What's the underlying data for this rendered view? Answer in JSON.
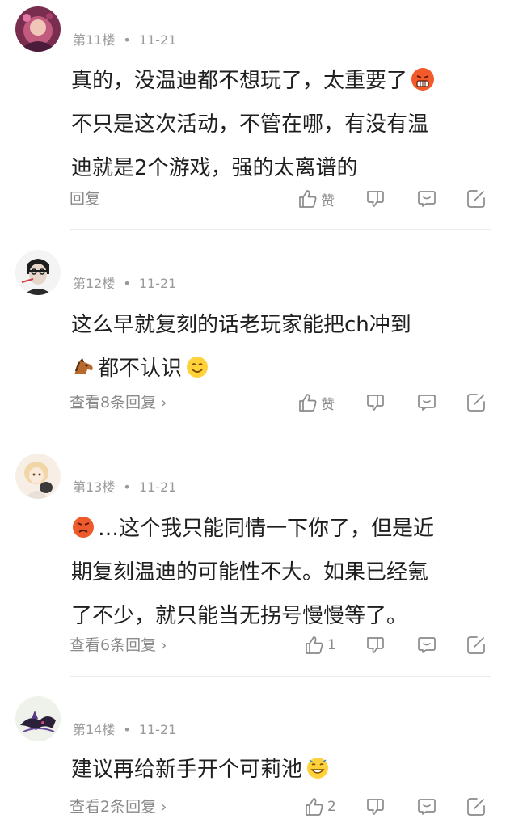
{
  "comments": [
    {
      "nickname": "",
      "floor": "第11楼",
      "date": "11-21",
      "lines": [
        "真的，没温迪都不想玩了，太重要了",
        "不只是这次活动，不管在哪，有没有温",
        "迪就是2个游戏，强的太离谱的"
      ],
      "emojis": [
        "angry-face-emoji"
      ],
      "reply_label": "回复",
      "like_label": "赞"
    },
    {
      "nickname": "",
      "floor": "第12楼",
      "date": "11-21",
      "lines": [
        "这么早就复刻的话老玩家能把ch冲到",
        "都不认识"
      ],
      "emojis": [
        "horse-emoji",
        "smile-emoji"
      ],
      "reply_label": "查看8条回复",
      "like_label": "赞"
    },
    {
      "nickname": "",
      "floor": "第13楼",
      "date": "11-21",
      "lines": [
        "…这个我只能同情一下你了，但是近",
        "期复刻温迪的可能性不大。如果已经氪",
        "了不少，就只能当无拐号慢慢等了。"
      ],
      "emojis": [
        "pouting-face-emoji"
      ],
      "reply_label": "查看6条回复",
      "like_label": "1"
    },
    {
      "nickname": "",
      "floor": "第14楼",
      "date": "11-21",
      "lines": [
        "建议再给新手开个可莉池"
      ],
      "emojis": [
        "grin-emoji"
      ],
      "reply_label": "查看2条回复",
      "like_label": "2"
    }
  ],
  "icons": {
    "like": "thumbs-up-icon",
    "dislike": "thumbs-down-icon",
    "reply": "comment-bubble-icon",
    "share": "share-icon",
    "chevron": "chevron-right-icon"
  },
  "colors": {
    "meta_text": "#9a9a9a",
    "body_text": "#1f1f1f",
    "icon": "#8a8a8a",
    "divider": "#ececec"
  }
}
